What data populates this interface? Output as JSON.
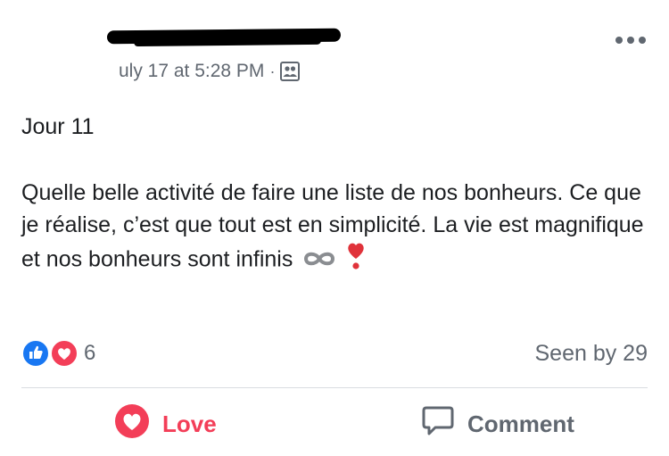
{
  "post": {
    "timestamp": "uly 17 at 5:28 PM",
    "separator": "·",
    "privacy_icon": "group-icon",
    "more_icon": "more-options-icon",
    "day_label": "Jour 11",
    "text_main": "Quelle belle activité de faire une liste de nos bonheurs. Ce que je réalise, c’est que tout est en simplicité. La vie est magnifique et nos bonheurs sont infinis",
    "emoji_1": "infinity-icon",
    "emoji_2": "heart-exclamation-icon"
  },
  "reactions": {
    "icons": [
      "like-icon",
      "love-icon"
    ],
    "count": "6",
    "seen_by": "Seen by 29"
  },
  "actions": {
    "love_label": "Love",
    "comment_label": "Comment"
  },
  "colors": {
    "love": "#f33e58",
    "like": "#1877f2",
    "muted": "#606770",
    "text": "#1c1e21"
  }
}
